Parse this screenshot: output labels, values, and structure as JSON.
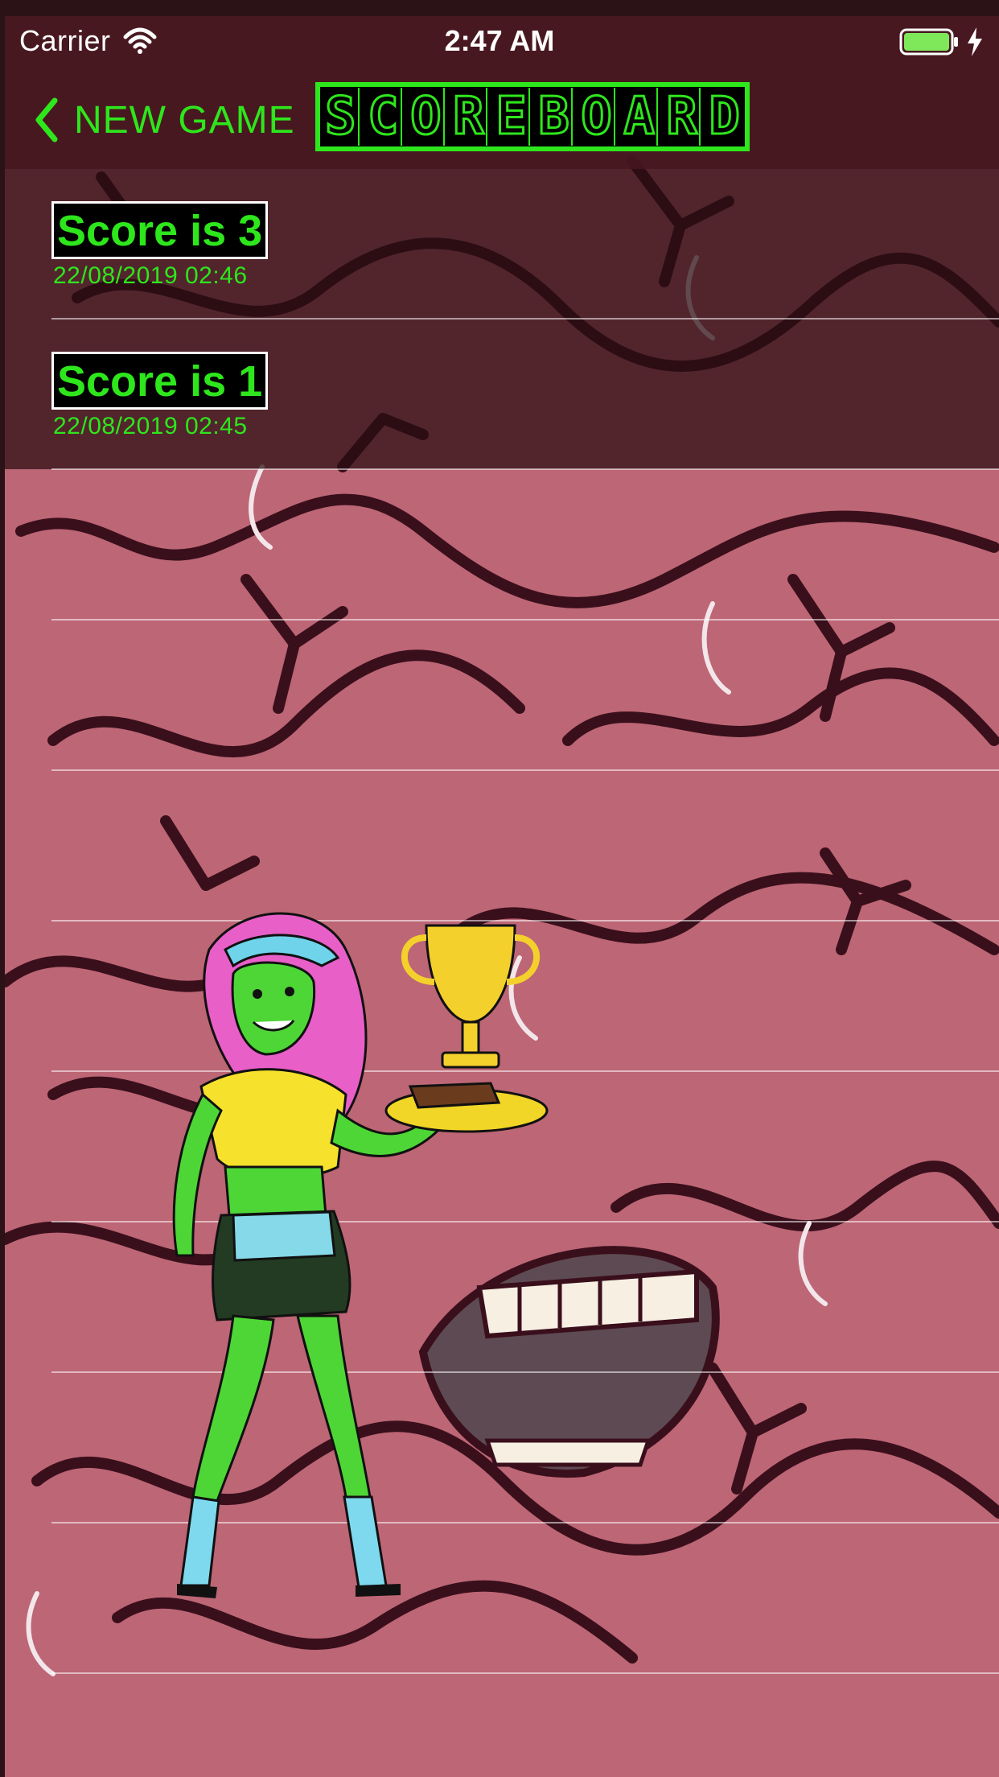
{
  "status_bar": {
    "carrier": "Carrier",
    "time": "2:47 AM",
    "wifi_icon": "wifi-icon",
    "battery_icon": "battery-icon",
    "charging_icon": "bolt-icon"
  },
  "nav": {
    "back_label": "NEW GAME",
    "back_icon": "chevron-left-icon",
    "title": "SCOREBOARD"
  },
  "scores": [
    {
      "label": "Score is 3",
      "date": "22/08/2019 02:46"
    },
    {
      "label": "Score is 1",
      "date": "22/08/2019 02:45"
    }
  ],
  "colors": {
    "accent": "#2ee61c",
    "brain": "#c06a78",
    "brain_crease": "#3a0f1c"
  }
}
